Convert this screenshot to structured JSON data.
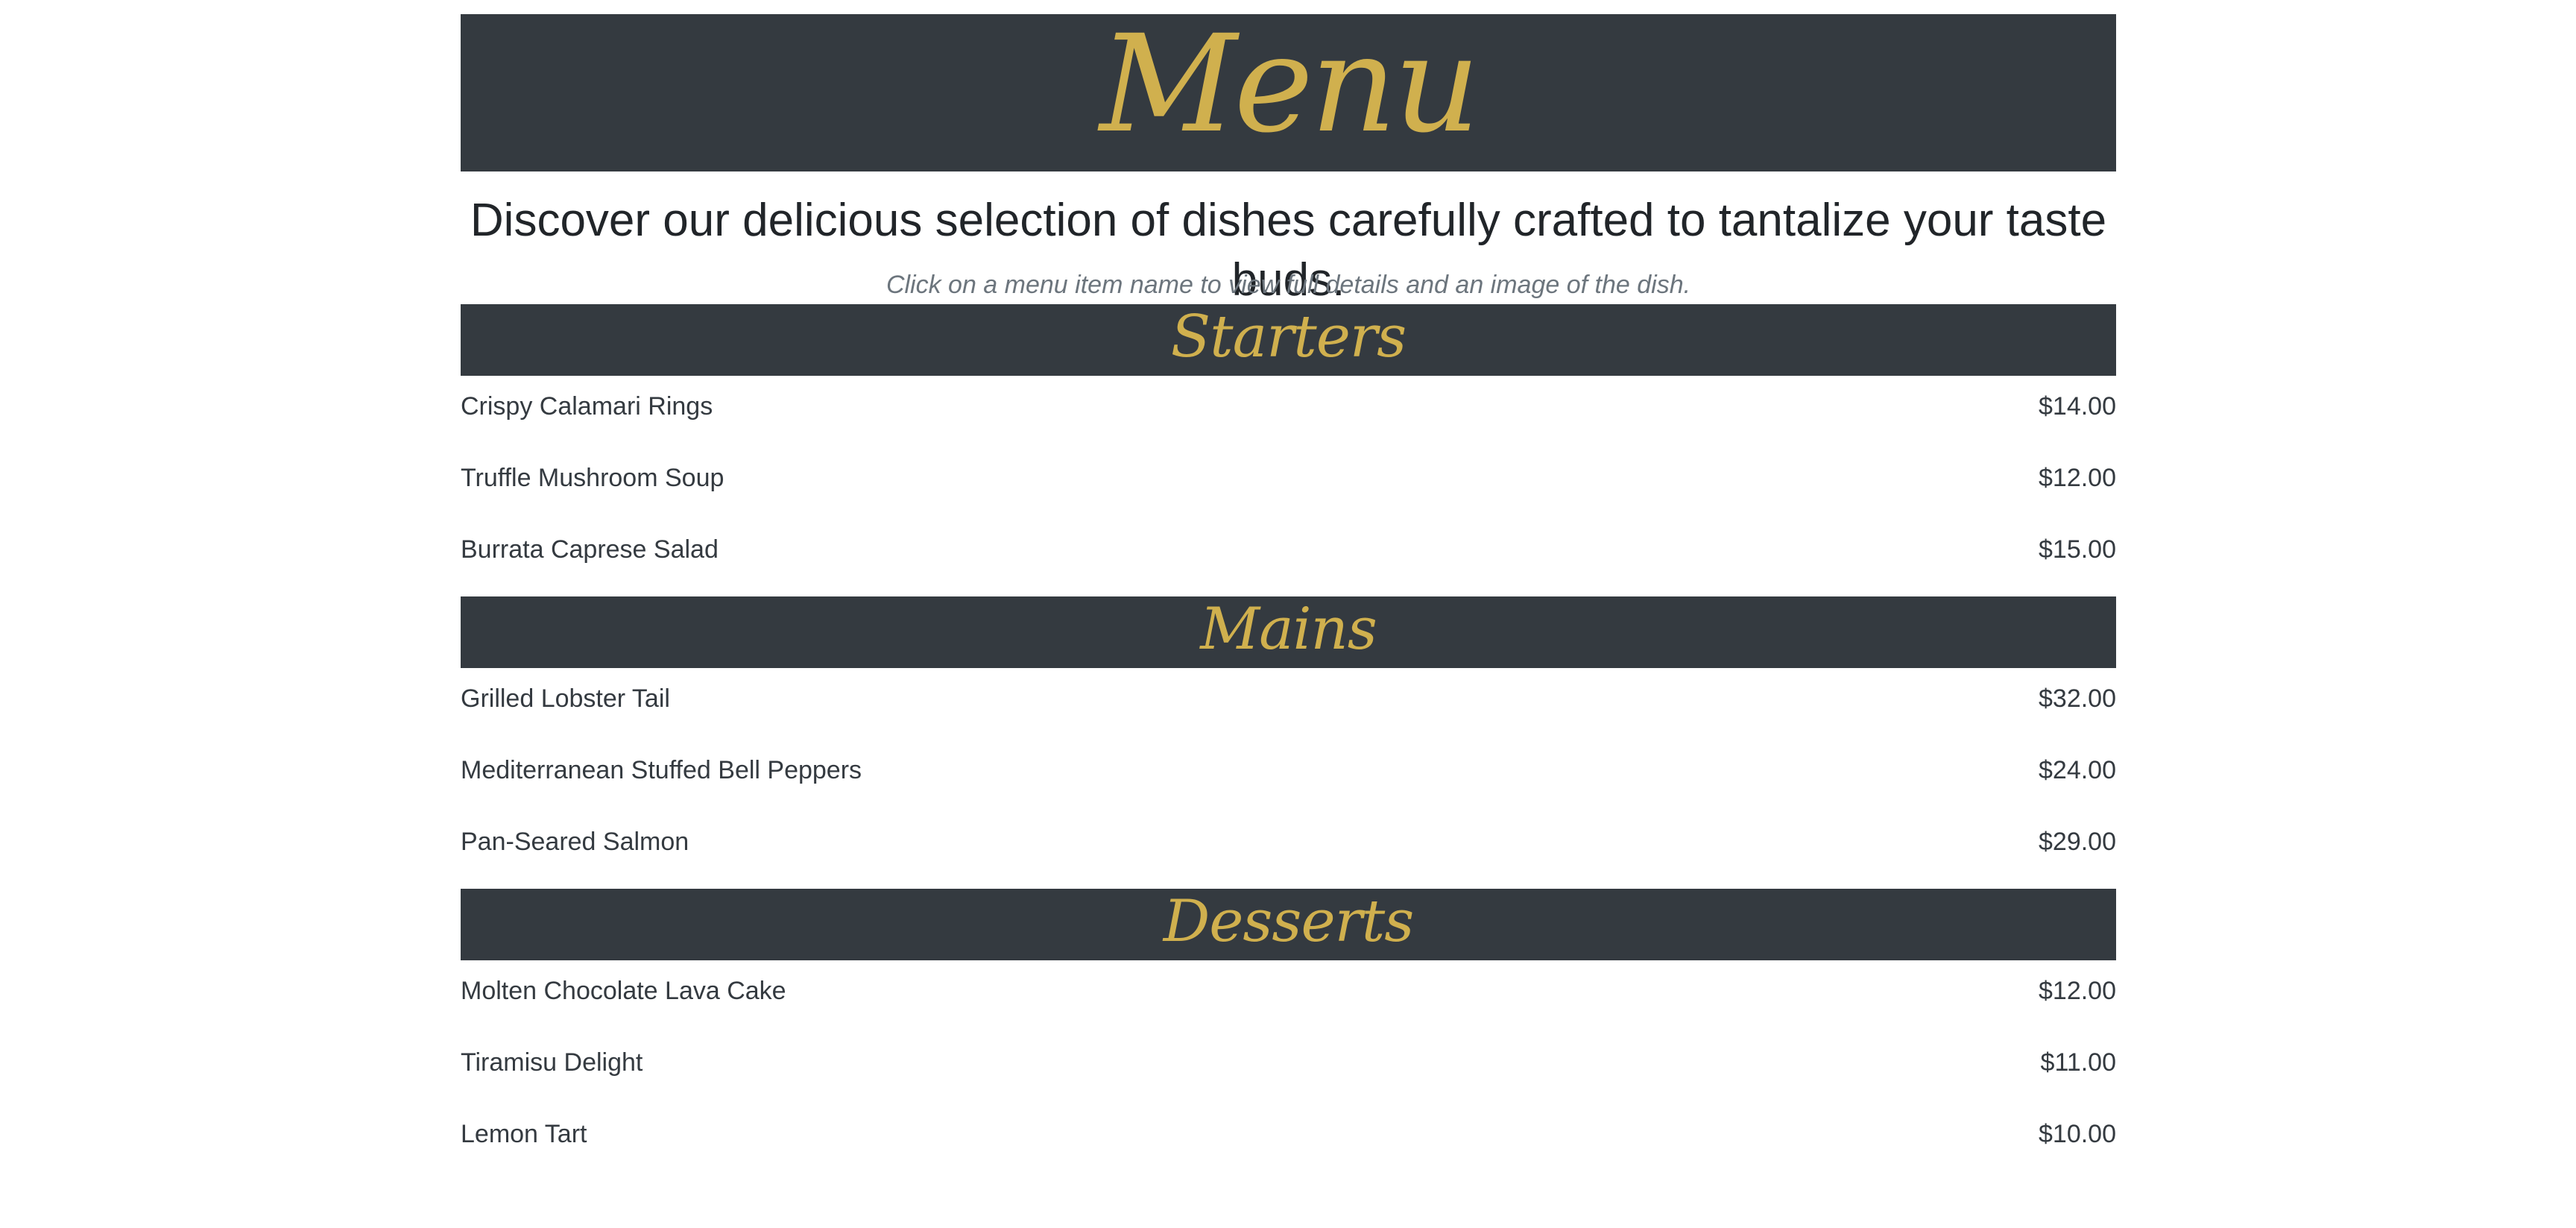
{
  "header": {
    "title": "Menu"
  },
  "intro": {
    "tagline": "Discover our delicious selection of dishes carefully crafted to tantalize your taste buds.",
    "hint": "Click on a menu item name to view full details and an image of the dish."
  },
  "colors": {
    "banner_bg": "#343a40",
    "accent_gold": "#d0b04e",
    "text": "#343a40",
    "muted": "#6c757d"
  },
  "sections": [
    {
      "title": "Starters",
      "items": [
        {
          "name": "Crispy Calamari Rings",
          "price": "$14.00"
        },
        {
          "name": "Truffle Mushroom Soup",
          "price": "$12.00"
        },
        {
          "name": "Burrata Caprese Salad",
          "price": "$15.00"
        }
      ]
    },
    {
      "title": "Mains",
      "items": [
        {
          "name": "Grilled Lobster Tail",
          "price": "$32.00"
        },
        {
          "name": "Mediterranean Stuffed Bell Peppers",
          "price": "$24.00"
        },
        {
          "name": "Pan-Seared Salmon",
          "price": "$29.00"
        }
      ]
    },
    {
      "title": "Desserts",
      "items": [
        {
          "name": "Molten Chocolate Lava Cake",
          "price": "$12.00"
        },
        {
          "name": "Tiramisu Delight",
          "price": "$11.00"
        },
        {
          "name": "Lemon Tart",
          "price": "$10.00"
        }
      ]
    }
  ]
}
